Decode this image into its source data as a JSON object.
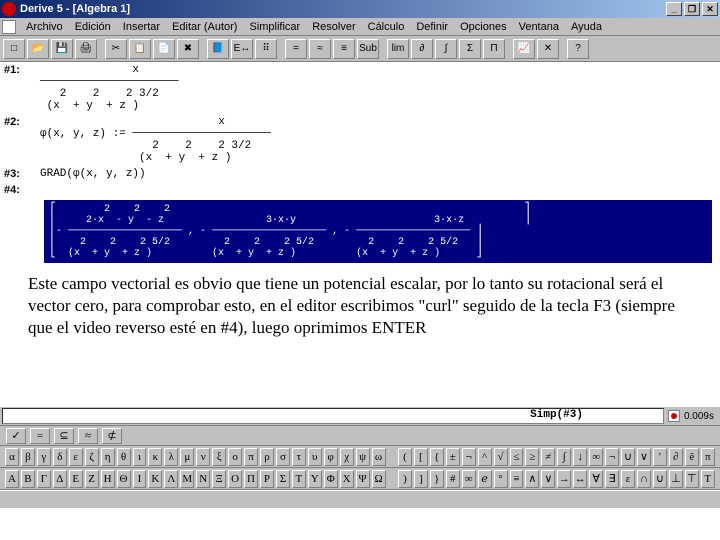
{
  "titlebar": {
    "title": "Derive 5 - [Algebra 1]"
  },
  "menu": [
    "Archivo",
    "Edición",
    "Insertar",
    "Editar (Autor)",
    "Simplificar",
    "Resolver",
    "Cálculo",
    "Definir",
    "Opciones",
    "Ventana",
    "Ayuda"
  ],
  "toolbar_icons": [
    "□",
    "📂",
    "💾",
    "🖨",
    "",
    "✂",
    "📋",
    "📄",
    "✖",
    "",
    "📘",
    "E↔",
    "⠿",
    "",
    "=",
    "≈",
    "≡",
    "Sub",
    "",
    "lim",
    "∂",
    "∫",
    "Σ",
    "Π",
    "",
    "📈",
    "✕",
    "",
    "?"
  ],
  "expr1": {
    "label": "#1:",
    "body": "              x\n─────────────────────\n   2    2    2 3/2\n (x  + y  + z )"
  },
  "expr2": {
    "label": "#2:",
    "body": "                           x\nφ(x, y, z) := ─────────────────────\n                 2    2    2 3/2\n               (x  + y  + z )"
  },
  "expr3": {
    "label": "#3:",
    "body": "GRAD(φ(x, y, z))"
  },
  "expr4": {
    "label": "#4:",
    "body": "⎡        2    2    2                                                           ⎤\n⎢     2·x  - y  - z                 3·x·y                       3·x·z          ⎥\n⎢- ─────────────────── , - ─────────────────── , - ─────────────────── ⎥\n⎢    2    2    2 5/2         2    2    2 5/2         2    2    2 5/2   ⎥\n⎣  (x  + y  + z )          (x  + y  + z )          (x  + y  + z )      ⎦"
  },
  "explanation": "Este campo vectorial es obvio que tiene un potencial escalar, por lo tanto su rotacional será el vector cero, para comprobar esto, en el editor escribimos \"curl\" seguido de la tecla F3 (siempre que el video reverso esté en #4), luego oprimimos ENTER",
  "entry": {
    "value": "Simp(#3)"
  },
  "status_time": "0.009s",
  "ops": [
    "✓",
    "=",
    "⊆",
    "≈",
    "⊄"
  ],
  "greek_lower": [
    "α",
    "β",
    "γ",
    "δ",
    "ε",
    "ζ",
    "η",
    "θ",
    "ι",
    "κ",
    "λ",
    "μ",
    "ν",
    "ξ",
    "ο",
    "π",
    "ρ",
    "σ",
    "τ",
    "υ",
    "φ",
    "χ",
    "ψ",
    "ω"
  ],
  "greek_upper": [
    "A",
    "B",
    "Γ",
    "Δ",
    "E",
    "Z",
    "H",
    "Θ",
    "I",
    "K",
    "Λ",
    "M",
    "N",
    "Ξ",
    "O",
    "Π",
    "P",
    "Σ",
    "T",
    "Y",
    "Φ",
    "X",
    "Ψ",
    "Ω"
  ],
  "sym_upper": [
    "(",
    "[",
    "{",
    "±",
    "¬",
    "^",
    "√",
    "≤",
    "≥",
    "≠",
    "∫",
    "↓",
    "∞",
    "¬",
    "∪",
    "∨",
    "'",
    "∂",
    "ê",
    "π"
  ],
  "sym_lower": [
    ")",
    "]",
    "}",
    "#",
    "∞",
    "ℯ",
    "°",
    "≡",
    "∧",
    "∨",
    "→",
    "↔",
    "∀",
    "∃",
    "ε",
    "∩",
    "∪",
    "⊥",
    "⊤",
    "T"
  ]
}
